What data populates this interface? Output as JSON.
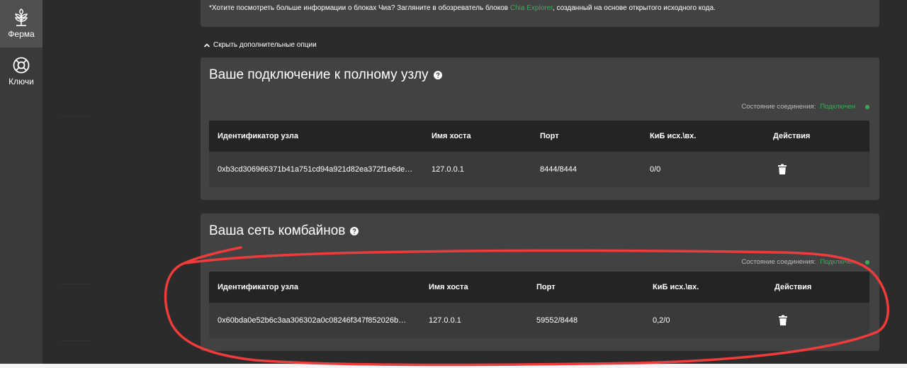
{
  "sidebar": {
    "items": [
      {
        "label": "Ферма",
        "icon": "farm-sprout-icon",
        "active": true
      },
      {
        "label": "Ключи",
        "icon": "keys-lifebuoy-icon",
        "active": false
      }
    ]
  },
  "info": {
    "text_before": "*Хотите посмотреть больше информации о блоках Чиа? Загляните в обозреватель блоков ",
    "link": "Chia Explorer",
    "text_after": ", созданный на основе открытого исходного кода."
  },
  "toggle": {
    "label": "Скрыть дополнительные опции"
  },
  "full_node": {
    "title": "Ваше подключение к полному узлу",
    "status_label": "Состояние соединения:",
    "status_value": "Подключен",
    "columns": [
      "Идентификатор узла",
      "Имя хоста",
      "Порт",
      "КиБ исх.\\вх.",
      "Действия"
    ],
    "rows": [
      [
        "0xb3cd306966371b41a751cd94a921d82ea372f1e6de…",
        "127.0.0.1",
        "8444/8444",
        "0/0"
      ]
    ]
  },
  "harvester": {
    "title": "Ваша сеть комбайнов",
    "status_label": "Состояние соединения:",
    "status_value": "Подключен",
    "columns": [
      "Идентификатор узла",
      "Имя хоста",
      "Порт",
      "КиБ исх.\\вх.",
      "Действия"
    ],
    "rows": [
      [
        "0x60bda0e52b6c3aa306302a0c08246f347f852026b…",
        "127.0.0.1",
        "59552/8448",
        "0,2/0"
      ]
    ]
  },
  "colors": {
    "accent": "#3aac59",
    "annotation": "#ee3b3b"
  }
}
